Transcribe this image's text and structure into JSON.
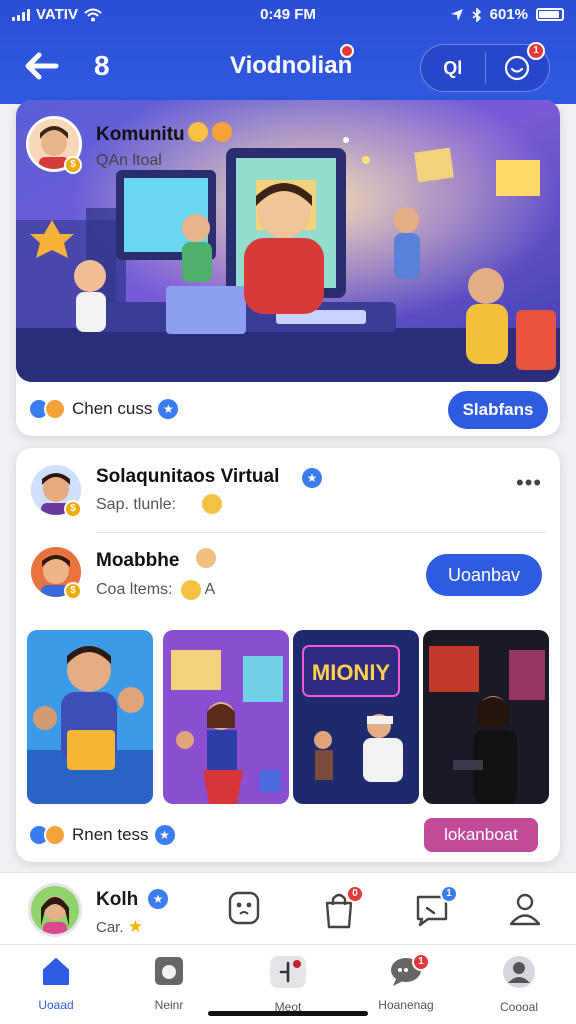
{
  "status_bar": {
    "carrier": "VATIV",
    "time": "0:49 FM",
    "battery": "601%"
  },
  "header": {
    "count": "8",
    "title": "Viodnolian",
    "pill_left": "Ql"
  },
  "card1": {
    "name": "Komunitu",
    "sub": "QAn ltoal",
    "reaction_text": "Chen cuss",
    "button": "Slabfans"
  },
  "card2": {
    "row1": {
      "name": "Solaqunitaos Virtual",
      "sub": "Sap. tlunle:"
    },
    "row2": {
      "name": "Moabbhe",
      "sub": "Coa ltems:",
      "sub_suffix": "A",
      "button": "Uoanbav"
    },
    "reaction_text": "Rnen tess",
    "button": "lokanboat"
  },
  "profile_bar": {
    "name": "Kolh",
    "sub": "Car."
  },
  "tabs": [
    {
      "label": "Uoaad",
      "icon": "home-icon",
      "active": true
    },
    {
      "label": "Neinr",
      "icon": "camera-icon",
      "active": false
    },
    {
      "label": "Meot",
      "icon": "compose-icon",
      "active": false
    },
    {
      "label": "Hoanenag",
      "icon": "chat-icon",
      "active": false
    },
    {
      "label": "Coooal",
      "icon": "person-icon",
      "active": false
    }
  ],
  "colors": {
    "primary": "#2f5be0",
    "accent_pink": "#c24a98",
    "badge_red": "#e23a3a"
  }
}
